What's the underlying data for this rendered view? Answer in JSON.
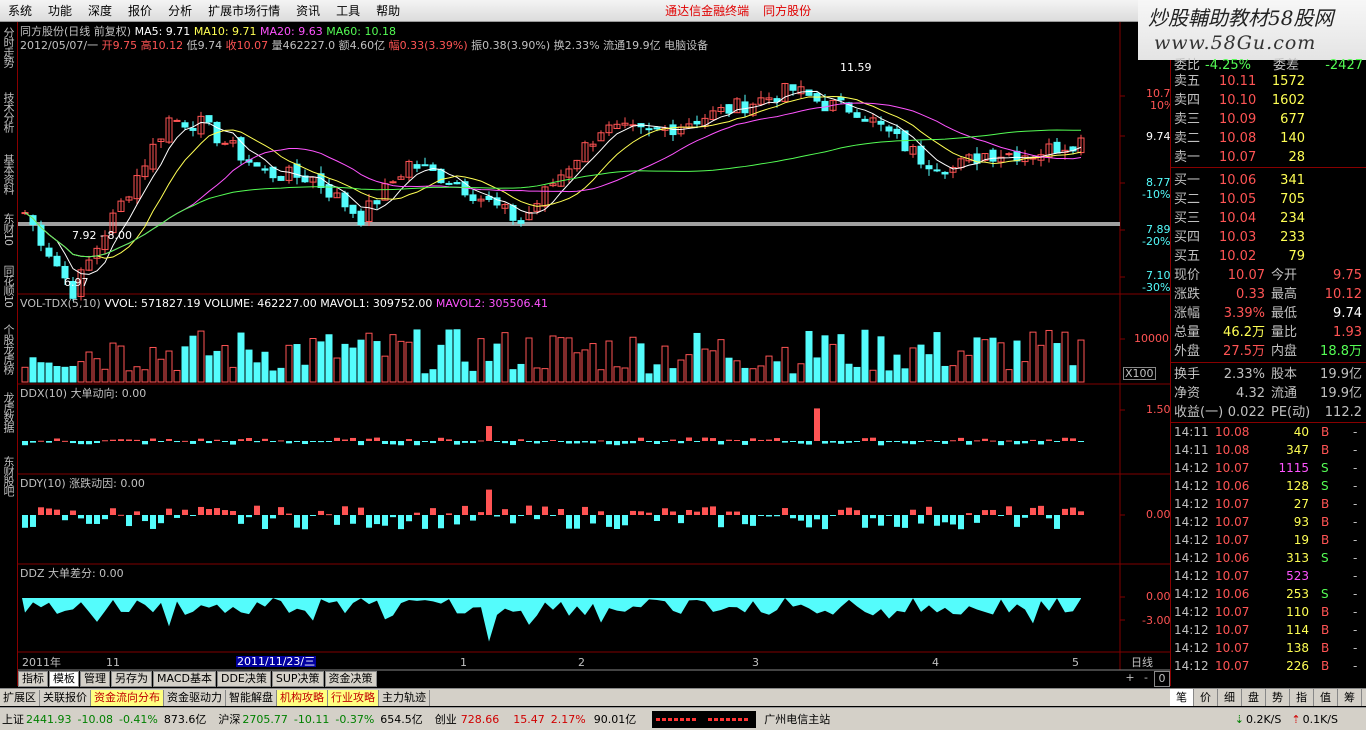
{
  "menu": {
    "items": [
      "系统",
      "功能",
      "深度",
      "报价",
      "分析",
      "扩展市场行情",
      "资讯",
      "工具",
      "帮助"
    ],
    "links": [
      "通达信金融终端",
      "同方股份"
    ]
  },
  "banner": {
    "title": "炒股輔助教材58股网",
    "url": "www.58Gu.com"
  },
  "sidebar": [
    "分时走势",
    "技术分析",
    "基本资料",
    "东财10",
    "同花顺10",
    "个股龙虎榜",
    "龙虎数据",
    "东财股吧"
  ],
  "kline": {
    "title": "同方股份(日线 前复权)",
    "ma5": "MA5: 9.71",
    "ma10": "MA10: 9.71",
    "ma20": "MA20: 9.63",
    "ma60": "MA60: 10.18",
    "info_date": "2012/05/07/一",
    "info_open": "开9.75",
    "info_high": "高10.12",
    "info_low": "低9.74",
    "info_close": "收10.07",
    "info_vol": "量462227.0",
    "info_amt": "额4.60亿",
    "info_chg": "幅0.33(3.39%)",
    "info_amp": "振0.38(3.90%)",
    "info_turn": "换2.33%",
    "info_float": "流通19.9亿",
    "info_ind": "电脑设备",
    "ann_high": "11.59",
    "ann_low1": "7.92 - 8.00",
    "ann_low2": "6.97",
    "scale": [
      {
        "v": "10.71",
        "p": "10%"
      },
      {
        "v": "9.74",
        "p": ""
      },
      {
        "v": "8.77",
        "p": "-10%"
      },
      {
        "v": "7.89",
        "p": "-20%"
      },
      {
        "v": "7.10",
        "p": "-30%"
      }
    ]
  },
  "vol": {
    "name": "VOL-TDX(5,10)",
    "vvol": "VVOL: 571827.19",
    "volume": "VOLUME: 462227.00",
    "mavol1": "MAVOL1: 309752.00",
    "mavol2": "MAVOL2: 305506.41",
    "scale": "10000",
    "unit": "X100"
  },
  "ddx": {
    "name": "DDX(10)",
    "desc": "大单动向: 0.00",
    "scale": "1.50"
  },
  "ddy": {
    "name": "DDY(10)",
    "desc": "涨跌动因: 0.00",
    "scale": "0.00"
  },
  "ddz": {
    "name": "DDZ",
    "desc": "大单差分: 0.00",
    "scale_top": "0.00",
    "scale_bot": "-3.00"
  },
  "xaxis": {
    "labels": [
      "2011年",
      "11",
      "2011/11/23/三",
      "1",
      "2",
      "3",
      "4",
      "5"
    ],
    "period": "日线"
  },
  "tabs1": [
    "指标",
    "模板",
    "管理",
    "另存为",
    "MACD基本",
    "DDE决策",
    "SUP决策",
    "资金决策"
  ],
  "tabs2": [
    "扩展区",
    "关联报价",
    "资金流向分布",
    "资金驱动力",
    "智能解盘",
    "机构攻略",
    "行业攻略",
    "主力轨迹"
  ],
  "rp": {
    "weibi_label": "委比",
    "weibi_val": "-4.25%",
    "weicha_label": "委差",
    "weicha_val": "-2427",
    "asks": [
      {
        "l": "卖五",
        "p": "10.11",
        "v": "1572"
      },
      {
        "l": "卖四",
        "p": "10.10",
        "v": "1602"
      },
      {
        "l": "卖三",
        "p": "10.09",
        "v": "677"
      },
      {
        "l": "卖二",
        "p": "10.08",
        "v": "140"
      },
      {
        "l": "卖一",
        "p": "10.07",
        "v": "28"
      }
    ],
    "bids": [
      {
        "l": "买一",
        "p": "10.06",
        "v": "341"
      },
      {
        "l": "买二",
        "p": "10.05",
        "v": "705"
      },
      {
        "l": "买三",
        "p": "10.04",
        "v": "234"
      },
      {
        "l": "买四",
        "p": "10.03",
        "v": "233"
      },
      {
        "l": "买五",
        "p": "10.02",
        "v": "79"
      }
    ],
    "quote": [
      {
        "l1": "现价",
        "v1": "10.07",
        "c1": "red",
        "l2": "今开",
        "v2": "9.75",
        "c2": "red"
      },
      {
        "l1": "涨跌",
        "v1": "0.33",
        "c1": "red",
        "l2": "最高",
        "v2": "10.12",
        "c2": "red"
      },
      {
        "l1": "涨幅",
        "v1": "3.39%",
        "c1": "red",
        "l2": "最低",
        "v2": "9.74",
        "c2": "wht"
      },
      {
        "l1": "总量",
        "v1": "46.2万",
        "c1": "yel",
        "l2": "量比",
        "v2": "1.93",
        "c2": "red"
      },
      {
        "l1": "外盘",
        "v1": "27.5万",
        "c1": "red",
        "l2": "内盘",
        "v2": "18.8万",
        "c2": "grn"
      },
      {
        "l1": "换手",
        "v1": "2.33%",
        "c1": "gry",
        "l2": "股本",
        "v2": "19.9亿",
        "c2": "gry"
      },
      {
        "l1": "净资",
        "v1": "4.32",
        "c1": "gry",
        "l2": "流通",
        "v2": "19.9亿",
        "c2": "gry"
      },
      {
        "l1": "收益(一)",
        "v1": "0.022",
        "c1": "gry",
        "l2": "PE(动)",
        "v2": "112.2",
        "c2": "gry"
      }
    ],
    "ticks": [
      {
        "t": "14:11",
        "p": "10.08",
        "v": "40",
        "s": "B",
        "vc": "yel"
      },
      {
        "t": "14:11",
        "p": "10.08",
        "v": "347",
        "s": "B",
        "vc": "yel"
      },
      {
        "t": "14:12",
        "p": "10.07",
        "v": "1115",
        "s": "S",
        "vc": "mag"
      },
      {
        "t": "14:12",
        "p": "10.06",
        "v": "128",
        "s": "S",
        "vc": "yel"
      },
      {
        "t": "14:12",
        "p": "10.07",
        "v": "27",
        "s": "B",
        "vc": "yel"
      },
      {
        "t": "14:12",
        "p": "10.07",
        "v": "93",
        "s": "B",
        "vc": "yel"
      },
      {
        "t": "14:12",
        "p": "10.07",
        "v": "19",
        "s": "B",
        "vc": "yel"
      },
      {
        "t": "14:12",
        "p": "10.06",
        "v": "313",
        "s": "S",
        "vc": "yel"
      },
      {
        "t": "14:12",
        "p": "10.07",
        "v": "523",
        "s": "",
        "vc": "mag"
      },
      {
        "t": "14:12",
        "p": "10.06",
        "v": "253",
        "s": "S",
        "vc": "yel"
      },
      {
        "t": "14:12",
        "p": "10.07",
        "v": "110",
        "s": "B",
        "vc": "yel"
      },
      {
        "t": "14:12",
        "p": "10.07",
        "v": "114",
        "s": "B",
        "vc": "yel"
      },
      {
        "t": "14:12",
        "p": "10.07",
        "v": "138",
        "s": "B",
        "vc": "yel"
      },
      {
        "t": "14:12",
        "p": "10.07",
        "v": "226",
        "s": "B",
        "vc": "yel"
      }
    ],
    "bottom_tabs": [
      "笔",
      "价",
      "细",
      "盘",
      "势",
      "指",
      "值",
      "筹"
    ]
  },
  "status": {
    "sh_label": "上证",
    "sh_val": "2441.93",
    "sh_chg": "-10.08",
    "sh_pct": "-0.41%",
    "sh_amt": "873.6亿",
    "sz_label": "沪深",
    "sz_val": "2705.77",
    "sz_chg": "-10.11",
    "sz_pct": "-0.37%",
    "sz_amt": "654.5亿",
    "cy_label": "创业",
    "cy_val": "728.66",
    "cy_chg": "15.47",
    "cy_pct": "2.17%",
    "cy_amt": "90.01亿",
    "server": "广州电信主站",
    "down": "0.2K/S",
    "up": "0.1K/S"
  },
  "colors": {
    "up": "#ff5454",
    "down": "#54fcfc",
    "ma5": "#ffffff",
    "ma10": "#ffff54",
    "ma20": "#ff54ff",
    "ma60": "#54fc54",
    "axis": "#800000"
  }
}
